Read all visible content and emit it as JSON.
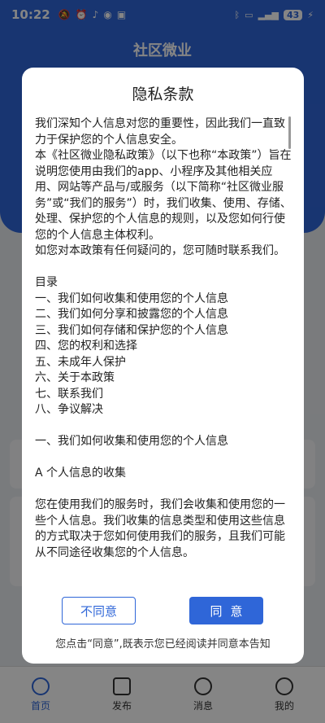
{
  "status_bar": {
    "time": "10:22",
    "battery": "43"
  },
  "app": {
    "title": "社区微业",
    "nav": [
      {
        "label": "首页"
      },
      {
        "label": "发布"
      },
      {
        "label": "消息"
      },
      {
        "label": "我的"
      }
    ]
  },
  "dialog": {
    "title": "隐私条款",
    "paragraphs": [
      "我们深知个人信息对您的重要性，因此我们一直致力于保护您的个人信息安全。",
      "本《社区微业隐私政策》（以下也称“本政策”）旨在说明您使用由我们的app、小程序及其他相关应用、网站等产品与/或服务（以下简称“社区微业服务”或“我们的服务”）时，我们收集、使用、存储、处理、保护您的个人信息的规则，以及您如何行使您的个人信息主体权利。",
      "如您对本政策有任何疑问的，您可随时联系我们。",
      "",
      "目录",
      "一、我们如何收集和使用您的个人信息",
      "二、我们如何分享和披露您的个人信息",
      "三、我们如何存储和保护您的个人信息",
      "四、您的权利和选择",
      "五、未成年人保护",
      "六、关于本政策",
      "七、联系我们",
      "八、争议解决",
      "",
      "一、我们如何收集和使用您的个人信息",
      "",
      "A  个人信息的收集",
      "",
      "您在使用我们的服务时，我们会收集和使用您的一些个人信息。我们收集的信息类型和使用这些信息的方式取决于您如何使用我们的服务，且我们可能从不同途径收集您的个人信息。"
    ],
    "decline_label": "不同意",
    "agree_label": "同意",
    "notice": "您点击“同意”,既表示您已经阅读并同意本告知"
  }
}
